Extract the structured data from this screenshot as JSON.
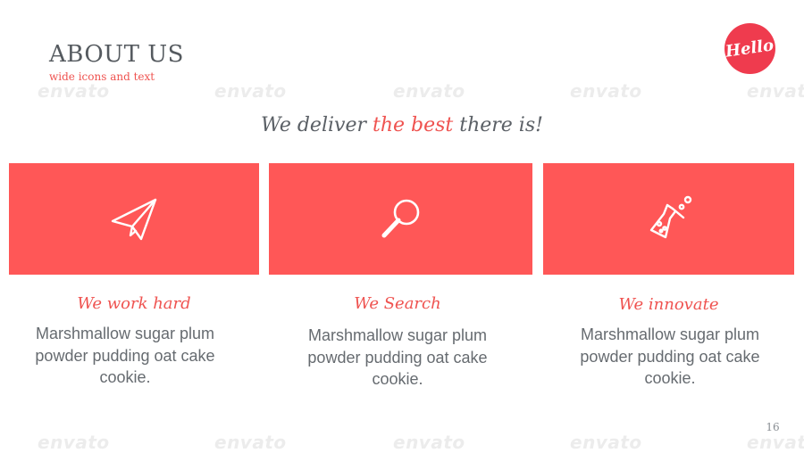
{
  "header": {
    "title": "ABOUT US",
    "subtitle": "wide icons and text",
    "logo_text": "Hello"
  },
  "tagline": {
    "before": "We deliver ",
    "accent": "the best",
    "after": " there is!"
  },
  "features": [
    {
      "icon": "paper-plane-icon",
      "title": "We work hard",
      "text": "Marshmallow sugar plum powder pudding oat cake cookie."
    },
    {
      "icon": "magnifier-icon",
      "title": "We Search",
      "text": "Marshmallow sugar plum powder pudding oat cake cookie."
    },
    {
      "icon": "flask-icon",
      "title": "We innovate",
      "text": "Marshmallow sugar plum powder pudding oat cake cookie."
    }
  ],
  "page_number": "16",
  "watermark_text": "envato",
  "colors": {
    "accent": "#ef5350",
    "card": "#ff5757",
    "logo": "#ef3b4e",
    "text": "#666b70"
  }
}
